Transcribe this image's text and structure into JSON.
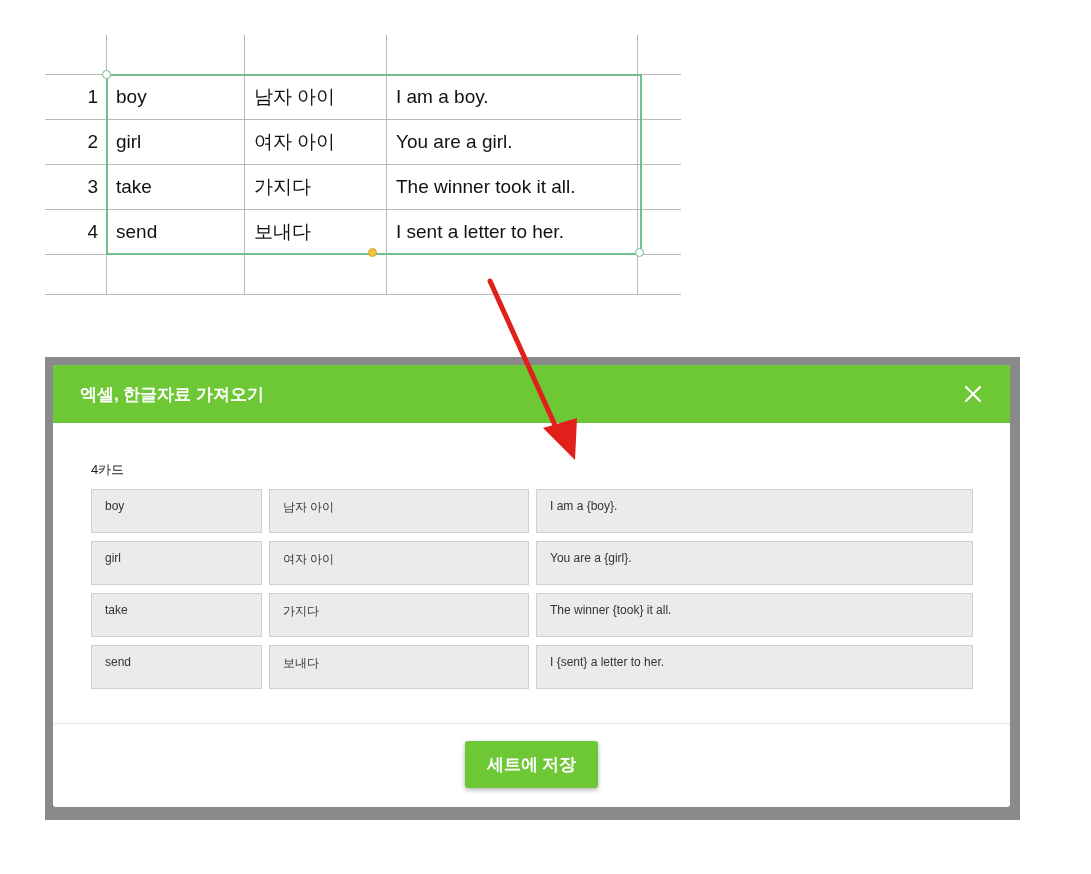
{
  "spreadsheet": {
    "rows": [
      {
        "row_number": "1",
        "cells": [
          "boy",
          "남자 아이",
          "I am a boy."
        ]
      },
      {
        "row_number": "2",
        "cells": [
          "girl",
          "여자 아이",
          "You are a girl."
        ]
      },
      {
        "row_number": "3",
        "cells": [
          "take",
          "가지다",
          "The winner took it all."
        ]
      },
      {
        "row_number": "4",
        "cells": [
          "send",
          "보내다",
          "I sent a letter to her."
        ]
      }
    ]
  },
  "dialog": {
    "title": "엑셀, 한글자료 가져오기",
    "count_label": "4카드",
    "cards": [
      [
        "boy",
        "남자 아이",
        "I am a {boy}."
      ],
      [
        "girl",
        "여자 아이",
        "You are a {girl}."
      ],
      [
        "take",
        "가지다",
        "The winner {took} it all."
      ],
      [
        "send",
        "보내다",
        "I {sent} a letter to her."
      ]
    ],
    "save_button": "세트에 저장"
  }
}
